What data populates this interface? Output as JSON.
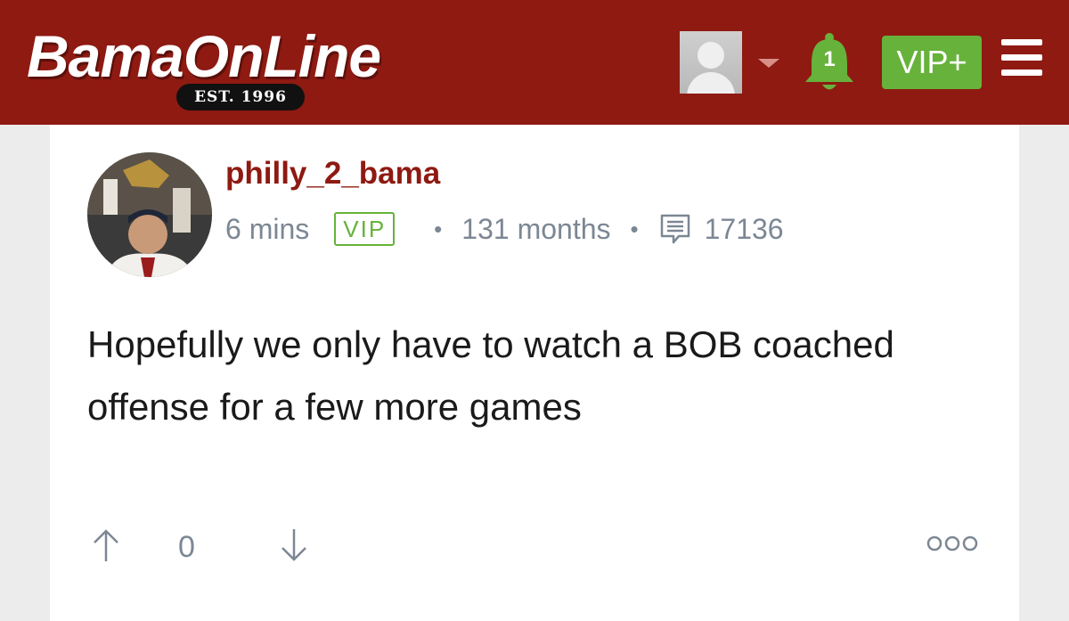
{
  "header": {
    "logo_text": "BamaOnLine",
    "logo_est": "EST. 1996",
    "notification_count": "1",
    "vip_button_label": "VIP+"
  },
  "post": {
    "username": "philly_2_bama",
    "time": "6 mins",
    "badge": "VIP",
    "membership": "131 months",
    "post_count": "17136",
    "body": "Hopefully we only have to watch a BOB coached offense for a few more games",
    "vote_count": "0"
  },
  "colors": {
    "header_bg": "#8e1a12",
    "accent_green": "#67b23b",
    "username": "#8e1a12",
    "meta_gray": "#7c8794"
  },
  "icons": [
    "avatar-icon",
    "caret-down-icon",
    "bell-icon",
    "hamburger-menu-icon",
    "comment-count-icon",
    "upvote-arrow-icon",
    "downvote-arrow-icon",
    "more-options-icon"
  ]
}
